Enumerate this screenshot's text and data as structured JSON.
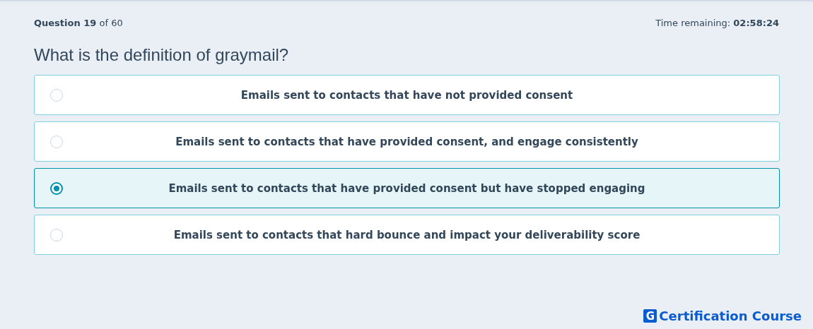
{
  "progress": "**Question 19** of 60",
  "timer": {
    "label": "Time remaining:",
    "value": "02:58:24"
  },
  "question": "What is the definition of graymail?",
  "options": [
    {
      "text": "Emails sent to contacts that have not provided consent",
      "selected": false
    },
    {
      "text": "Emails sent to contacts that have provided consent, and engage consistently",
      "selected": false
    },
    {
      "text": "Emails sent to contacts that have provided consent but have stopped engaging",
      "selected": true
    },
    {
      "text": "Emails sent to contacts that hard bounce and impact your deliverability score",
      "selected": false
    }
  ],
  "brand": {
    "mark": "G",
    "name": "Certification Course"
  }
}
